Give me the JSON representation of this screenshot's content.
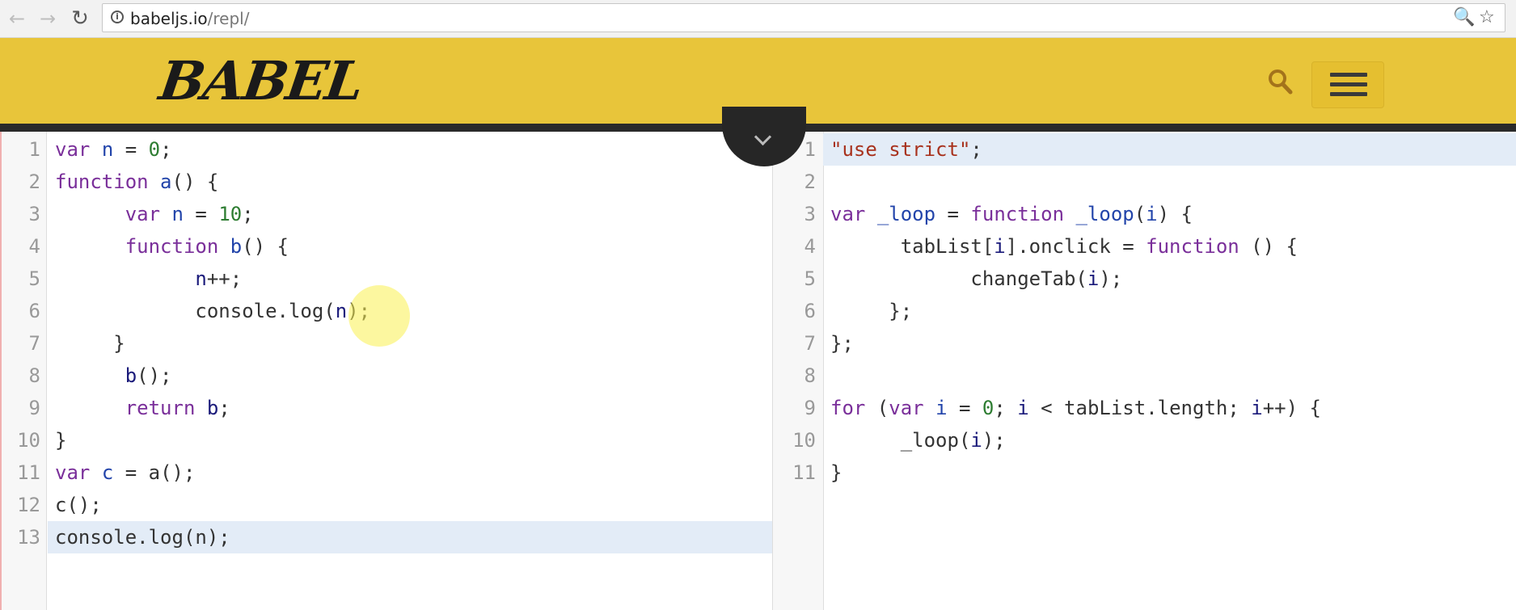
{
  "browser": {
    "back_icon": "arrow-left-icon",
    "forward_icon": "arrow-right-icon",
    "reload_icon": "reload-icon",
    "url_host": "babeljs.io",
    "url_path": "/repl/",
    "zoom_icon": "zoom-icon",
    "bookmark_icon": "star-icon"
  },
  "header": {
    "logo_text": "BABEL",
    "brand_color": "#e8c53a",
    "search_icon": "search-icon",
    "menu_icon": "hamburger-menu-icon"
  },
  "input_editor": {
    "lines": [
      {
        "num": "1",
        "html": "<span class=\"kw\">var</span> <span class=\"def\">n</span> = <span class=\"num\">0</span>;"
      },
      {
        "num": "2",
        "html": "<span class=\"kw\">function</span> <span class=\"def\">a</span>() {"
      },
      {
        "num": "3",
        "html": "      <span class=\"kw\">var</span> <span class=\"def\">n</span> = <span class=\"num\">10</span>;"
      },
      {
        "num": "4",
        "html": "      <span class=\"kw\">function</span> <span class=\"def\">b</span>() {"
      },
      {
        "num": "5",
        "html": "            <span class=\"var2\">n</span>++;"
      },
      {
        "num": "6",
        "html": "            console.log(<span class=\"var2\">n</span>);"
      },
      {
        "num": "7",
        "html": "     }"
      },
      {
        "num": "8",
        "html": "      <span class=\"var2\">b</span>();"
      },
      {
        "num": "9",
        "html": "      <span class=\"kw\">return</span> <span class=\"var2\">b</span>;"
      },
      {
        "num": "10",
        "html": "}"
      },
      {
        "num": "11",
        "html": "<span class=\"kw\">var</span> <span class=\"def\">c</span> = a();"
      },
      {
        "num": "12",
        "html": "c();"
      },
      {
        "num": "13",
        "html": "console.log(n);"
      }
    ],
    "active_line": 13
  },
  "output_editor": {
    "lines": [
      {
        "num": "1",
        "html": "<span class=\"str\">\"use strict\"</span>;"
      },
      {
        "num": "2",
        "html": ""
      },
      {
        "num": "3",
        "html": "<span class=\"kw\">var</span> <span class=\"def\">_loop</span> = <span class=\"kw\">function</span> <span class=\"def\">_loop</span>(<span class=\"def\">i</span>) {"
      },
      {
        "num": "4",
        "html": "      tabList[<span class=\"var2\">i</span>].onclick = <span class=\"kw\">function</span> () {"
      },
      {
        "num": "5",
        "html": "            changeTab(<span class=\"var2\">i</span>);"
      },
      {
        "num": "6",
        "html": "     };"
      },
      {
        "num": "7",
        "html": "};"
      },
      {
        "num": "8",
        "html": ""
      },
      {
        "num": "9",
        "html": "<span class=\"kw\">for</span> (<span class=\"kw\">var</span> <span class=\"def\">i</span> = <span class=\"num\">0</span>; <span class=\"var2\">i</span> &lt; tabList.length; <span class=\"var2\">i</span>++) {"
      },
      {
        "num": "10",
        "html": "      _loop(<span class=\"var2\">i</span>);"
      },
      {
        "num": "11",
        "html": "}"
      }
    ],
    "active_line": 1
  },
  "toggle_icon": "chevron-down-icon"
}
